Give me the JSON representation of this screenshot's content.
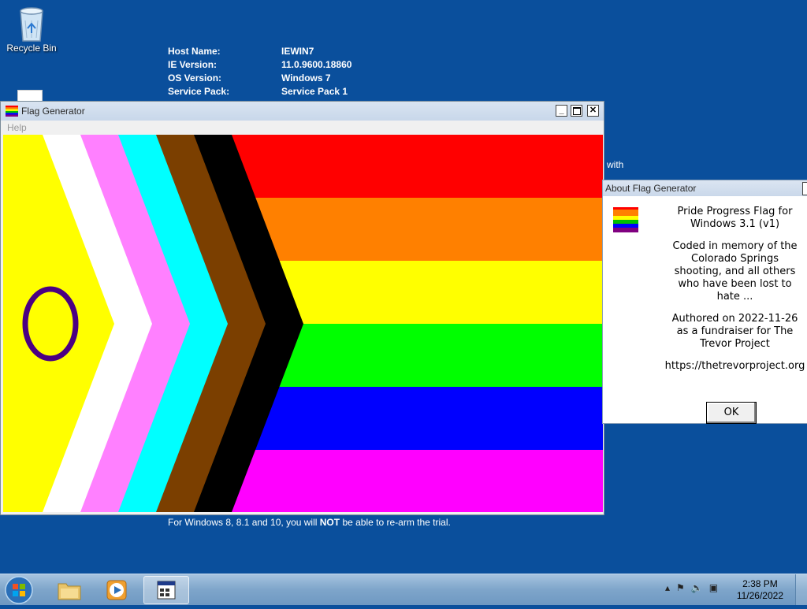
{
  "desktop": {
    "recycle_bin_label": "Recycle Bin",
    "info": [
      {
        "key": "Host Name:",
        "value": "IEWIN7"
      },
      {
        "key": "IE Version:",
        "value": "11.0.9600.18860"
      },
      {
        "key": "OS Version:",
        "value": "Windows 7"
      },
      {
        "key": "Service Pack:",
        "value": "Service Pack 1"
      }
    ],
    "partial_text_with": "with",
    "footer_text_pre": "For Windows 8, 8.1 and 10, you will ",
    "footer_text_bold": "NOT",
    "footer_text_post": " be able to re-arm the trial."
  },
  "flag_window": {
    "title": "Flag Generator",
    "menu_help": "Help",
    "stripe_colors": [
      "#ff0000",
      "#ff8000",
      "#ffff00",
      "#00ff00",
      "#0000ff",
      "#ff00ff"
    ],
    "chevron_colors": [
      "#000000",
      "#7b3f00",
      "#00ffff",
      "#ff80ff",
      "#ffffff",
      "#ffff00"
    ],
    "circle_color": "#4b0082"
  },
  "about_dialog": {
    "title": "About Flag Generator",
    "line1": "Pride Progress Flag for Windows 3.1 (v1)",
    "line2": "Coded in memory of the Colorado Springs shooting, and all others who have been lost to hate ...",
    "line3": "Authored on 2022-11-26 as a fundraiser for The Trevor Project",
    "line4": "https://thetrevorproject.org",
    "ok_label": "OK"
  },
  "taskbar": {
    "time": "2:38 PM",
    "date": "11/26/2022"
  }
}
